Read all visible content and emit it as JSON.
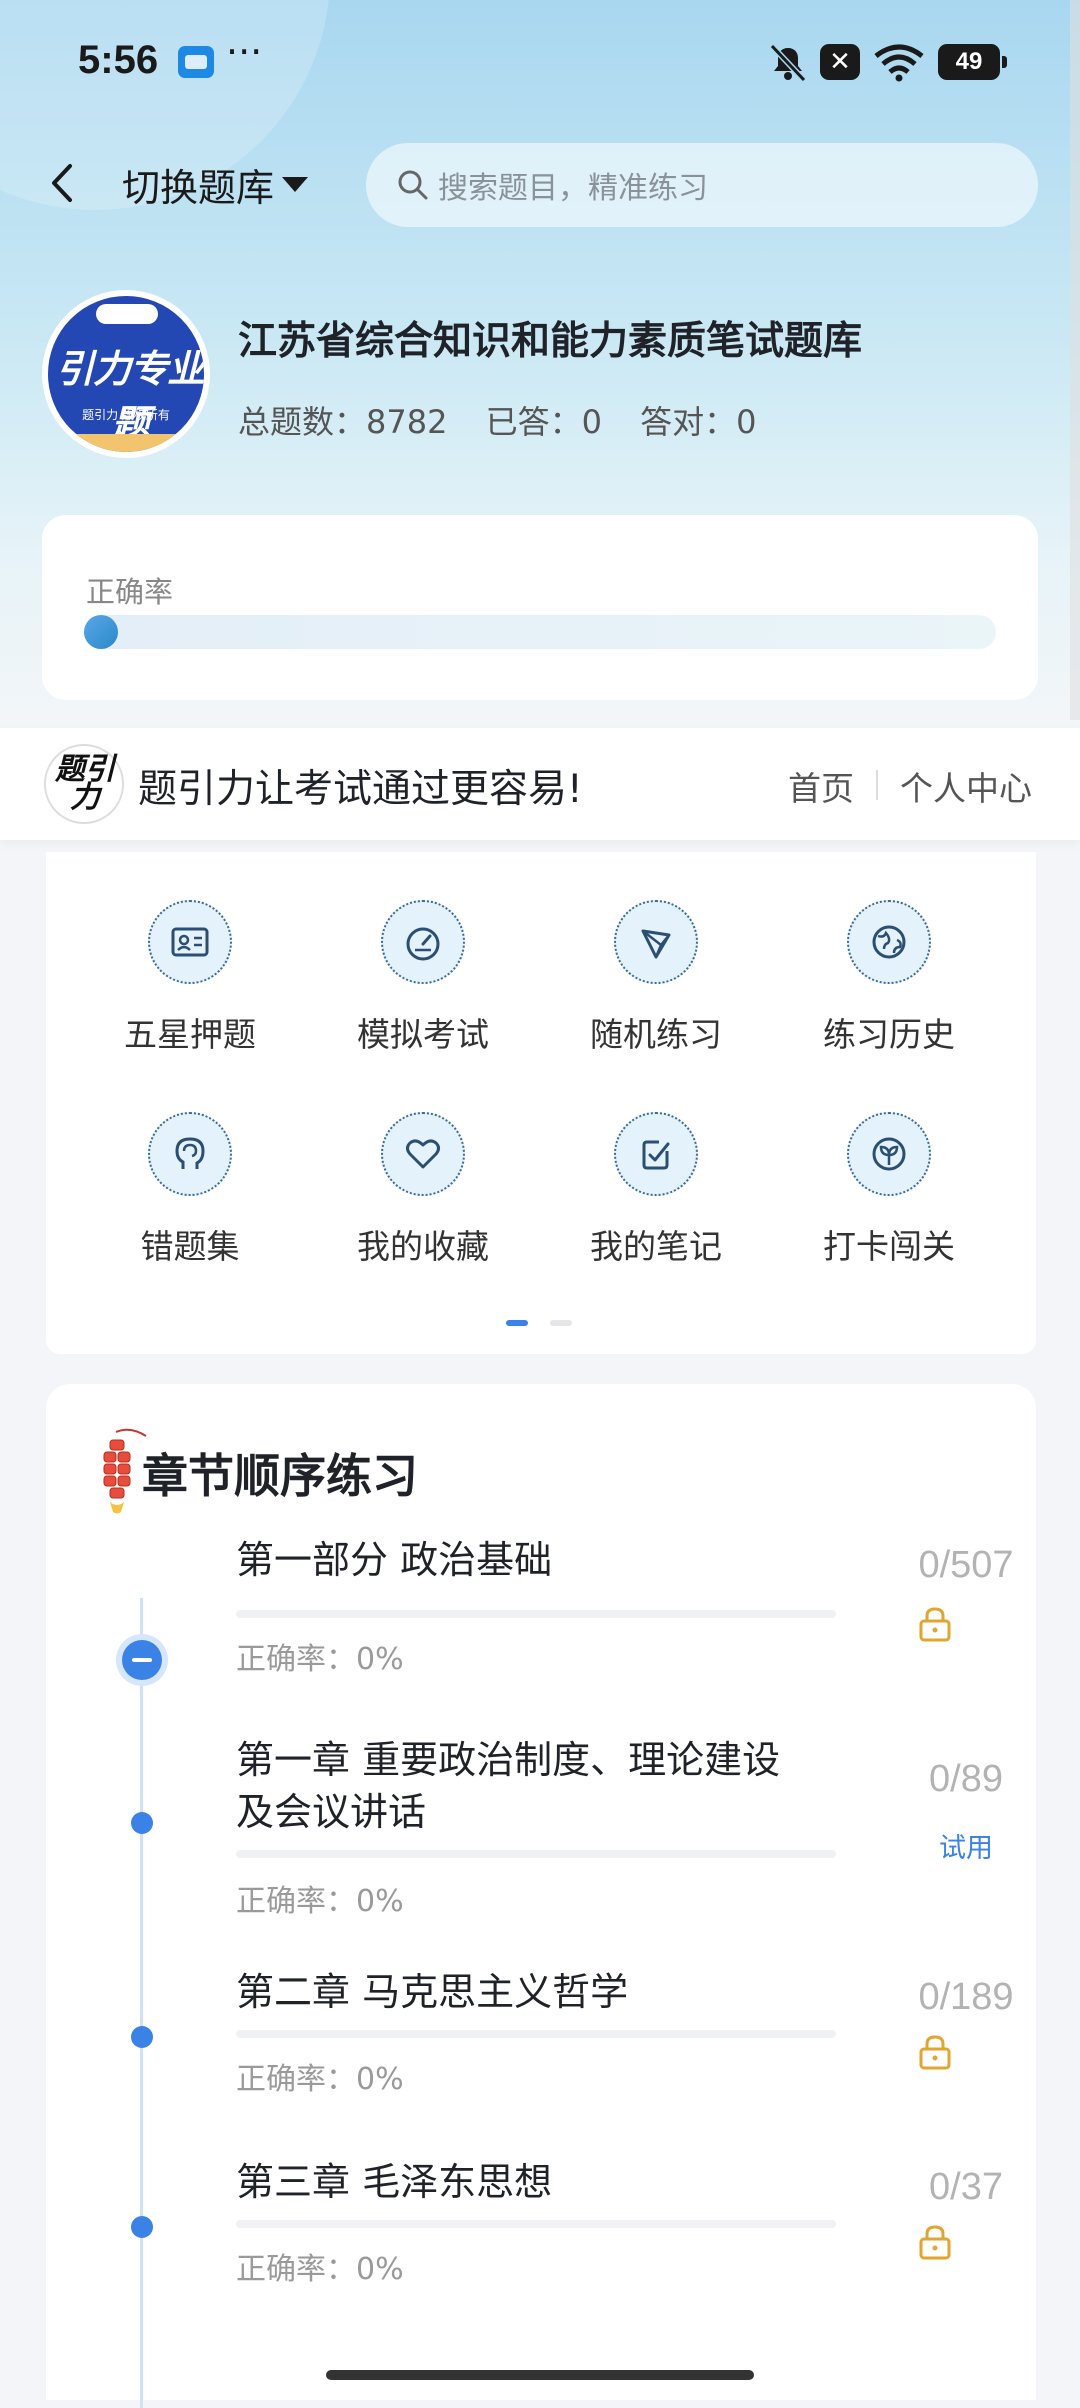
{
  "status_bar": {
    "time": "5:56",
    "battery": "49"
  },
  "header": {
    "switch_label": "切换题库",
    "search_placeholder": "搜索题目，精准练习"
  },
  "bank": {
    "logo_text": "引力专业题",
    "logo_sub": "题引力 版权所有",
    "title": "江苏省综合知识和能力素质笔试题库",
    "total_label": "总题数：8782",
    "answered_label": "已答：0",
    "correct_label": "答对：0"
  },
  "accuracy": {
    "label": "正确率",
    "value": 0
  },
  "promo": {
    "logo_text": "题引力",
    "text": "题引力让考试通过更容易!",
    "home": "首页",
    "me": "个人中心"
  },
  "features": [
    {
      "label": "五星押题",
      "icon": "id-card-icon"
    },
    {
      "label": "模拟考试",
      "icon": "speedometer-icon"
    },
    {
      "label": "随机练习",
      "icon": "random-network-icon"
    },
    {
      "label": "练习历史",
      "icon": "globe-icon"
    },
    {
      "label": "错题集",
      "icon": "brain-head-icon"
    },
    {
      "label": "我的收藏",
      "icon": "heart-icon"
    },
    {
      "label": "我的笔记",
      "icon": "note-check-icon"
    },
    {
      "label": "打卡闯关",
      "icon": "sprout-icon"
    }
  ],
  "pager": {
    "current": 1,
    "total": 2
  },
  "chapters": {
    "section_title": "章节顺序练习",
    "items": [
      {
        "name": "第一部分 政治基础",
        "accuracy": "正确率：0%",
        "count": "0/507",
        "status": "locked"
      },
      {
        "name": "第一章 重要政治制度、理论建设及会议讲话",
        "accuracy": "正确率：0%",
        "count": "0/89",
        "status": "trial",
        "trial_label": "试用"
      },
      {
        "name": "第二章 马克思主义哲学",
        "accuracy": "正确率：0%",
        "count": "0/189",
        "status": "locked"
      },
      {
        "name": "第三章 毛泽东思想",
        "accuracy": "正确率：0%",
        "count": "0/37",
        "status": "locked"
      }
    ]
  }
}
